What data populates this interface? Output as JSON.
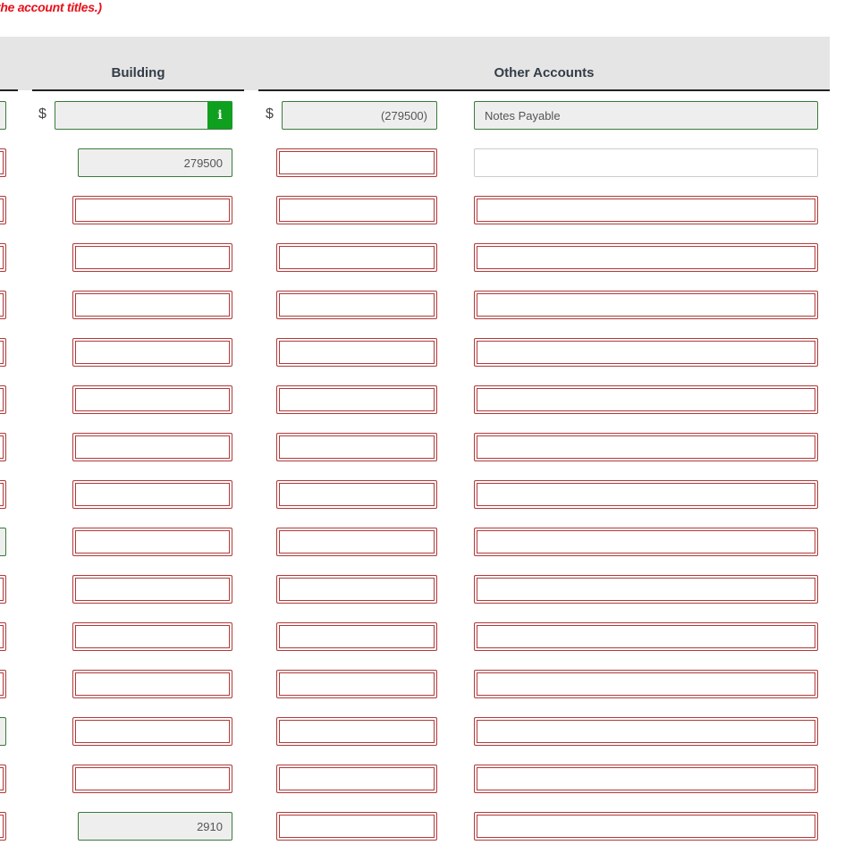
{
  "instruction": "the account titles.)",
  "columns": {
    "building": "Building",
    "other": "Other Accounts"
  },
  "currency": "$",
  "info_icon": "info-icon",
  "rows": [
    {
      "left": "green",
      "building": {
        "state": "green",
        "value": ""
      },
      "col3": {
        "state": "green",
        "value": "(279500)"
      },
      "other": {
        "state": "green",
        "value": "Notes Payable"
      }
    },
    {
      "left": "red",
      "building": {
        "state": "gray",
        "value": "279500"
      },
      "col3": {
        "state": "red",
        "value": ""
      },
      "other": {
        "state": "plain",
        "value": ""
      }
    },
    {
      "left": "red",
      "building": {
        "state": "red",
        "value": ""
      },
      "col3": {
        "state": "red",
        "value": ""
      },
      "other": {
        "state": "red",
        "value": ""
      }
    },
    {
      "left": "red",
      "building": {
        "state": "red",
        "value": ""
      },
      "col3": {
        "state": "red",
        "value": ""
      },
      "other": {
        "state": "red",
        "value": ""
      }
    },
    {
      "left": "red",
      "building": {
        "state": "red",
        "value": ""
      },
      "col3": {
        "state": "red",
        "value": ""
      },
      "other": {
        "state": "red",
        "value": ""
      }
    },
    {
      "left": "red",
      "building": {
        "state": "red",
        "value": ""
      },
      "col3": {
        "state": "red",
        "value": ""
      },
      "other": {
        "state": "red",
        "value": ""
      }
    },
    {
      "left": "red",
      "building": {
        "state": "red",
        "value": ""
      },
      "col3": {
        "state": "red",
        "value": ""
      },
      "other": {
        "state": "red",
        "value": ""
      }
    },
    {
      "left": "red",
      "building": {
        "state": "red",
        "value": ""
      },
      "col3": {
        "state": "red",
        "value": ""
      },
      "other": {
        "state": "red",
        "value": ""
      }
    },
    {
      "left": "red",
      "building": {
        "state": "red",
        "value": ""
      },
      "col3": {
        "state": "red",
        "value": ""
      },
      "other": {
        "state": "red",
        "value": ""
      }
    },
    {
      "left": "green",
      "building": {
        "state": "red",
        "value": ""
      },
      "col3": {
        "state": "red",
        "value": ""
      },
      "other": {
        "state": "red",
        "value": ""
      }
    },
    {
      "left": "red",
      "building": {
        "state": "red",
        "value": ""
      },
      "col3": {
        "state": "red",
        "value": ""
      },
      "other": {
        "state": "red",
        "value": ""
      }
    },
    {
      "left": "red",
      "building": {
        "state": "red",
        "value": ""
      },
      "col3": {
        "state": "red",
        "value": ""
      },
      "other": {
        "state": "red",
        "value": ""
      }
    },
    {
      "left": "red",
      "building": {
        "state": "red",
        "value": ""
      },
      "col3": {
        "state": "red",
        "value": ""
      },
      "other": {
        "state": "red",
        "value": ""
      }
    },
    {
      "left": "green",
      "building": {
        "state": "red",
        "value": ""
      },
      "col3": {
        "state": "red",
        "value": ""
      },
      "other": {
        "state": "red",
        "value": ""
      }
    },
    {
      "left": "red",
      "building": {
        "state": "red",
        "value": ""
      },
      "col3": {
        "state": "red",
        "value": ""
      },
      "other": {
        "state": "red",
        "value": ""
      }
    },
    {
      "left": "red",
      "building": {
        "state": "gray",
        "value": "2910"
      },
      "col3": {
        "state": "red",
        "value": ""
      },
      "other": {
        "state": "red",
        "value": ""
      }
    }
  ]
}
